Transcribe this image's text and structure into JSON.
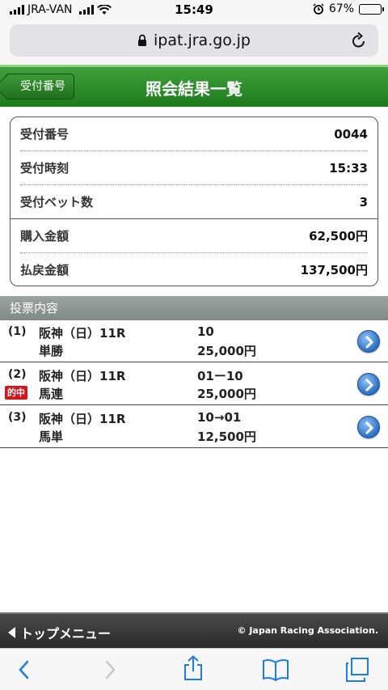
{
  "status_bar": {
    "carrier": "JRA-VAN",
    "time": "15:49",
    "battery": "67%",
    "battery_level": 0.67
  },
  "browser": {
    "url": "ipat.jra.go.jp"
  },
  "header": {
    "back_label": "受付番号",
    "title": "照会結果一覧"
  },
  "summary": [
    {
      "label": "受付番号",
      "value": "0044"
    },
    {
      "label": "受付時刻",
      "value": "15:33"
    },
    {
      "label": "受付ベット数",
      "value": "3"
    },
    {
      "label": "購入金額",
      "value": "62,500円"
    },
    {
      "label": "払戻金額",
      "value": "137,500円"
    }
  ],
  "section_title": "投票内容",
  "bets": [
    {
      "num": "(1)",
      "race": "阪神（日）11R",
      "type": "単勝",
      "combo": "10",
      "amount": "25,000円",
      "hit": ""
    },
    {
      "num": "(2)",
      "race": "阪神（日）11R",
      "type": "馬連",
      "combo": "01ー10",
      "amount": "25,000円",
      "hit": "的中"
    },
    {
      "num": "(3)",
      "race": "阪神（日）11R",
      "type": "馬単",
      "combo": "10→01",
      "amount": "12,500円",
      "hit": ""
    }
  ],
  "footer": {
    "top_menu": "トップメニュー",
    "copyright": "© Japan Racing Association."
  },
  "colors": {
    "header_green": "#1d7a1b",
    "hit_red": "#d8141b",
    "arrow_blue": "#2a6fc4"
  }
}
